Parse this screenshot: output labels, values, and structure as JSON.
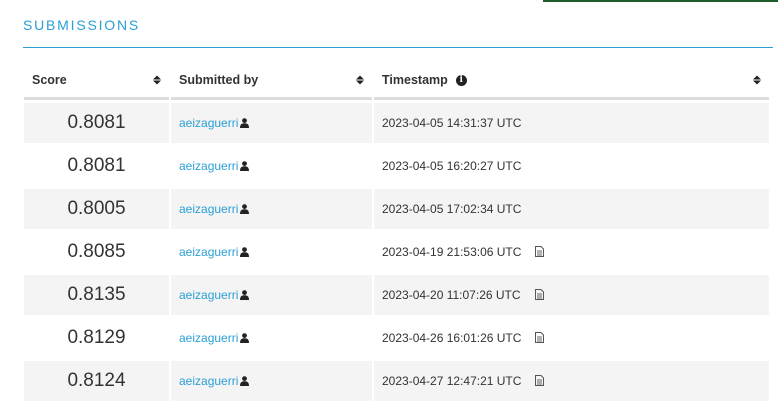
{
  "section_title": "SUBMISSIONS",
  "columns": {
    "score": "Score",
    "submitted_by": "Submitted by",
    "timestamp": "Timestamp"
  },
  "rows": [
    {
      "score": "0.8081",
      "user": "aeizaguerri",
      "timestamp": "2023-04-05 14:31:37 UTC",
      "has_file": false
    },
    {
      "score": "0.8081",
      "user": "aeizaguerri",
      "timestamp": "2023-04-05 16:20:27 UTC",
      "has_file": false
    },
    {
      "score": "0.8005",
      "user": "aeizaguerri",
      "timestamp": "2023-04-05 17:02:34 UTC",
      "has_file": false
    },
    {
      "score": "0.8085",
      "user": "aeizaguerri",
      "timestamp": "2023-04-19 21:53:06 UTC",
      "has_file": true
    },
    {
      "score": "0.8135",
      "user": "aeizaguerri",
      "timestamp": "2023-04-20 11:07:26 UTC",
      "has_file": true
    },
    {
      "score": "0.8129",
      "user": "aeizaguerri",
      "timestamp": "2023-04-26 16:01:26 UTC",
      "has_file": true
    },
    {
      "score": "0.8124",
      "user": "aeizaguerri",
      "timestamp": "2023-04-27 12:47:21 UTC",
      "has_file": true
    }
  ],
  "icons": {
    "user": "user-icon",
    "file": "file-icon",
    "info": "info-icon",
    "sort": "sort-icon"
  },
  "colors": {
    "accent": "#2a9fd6",
    "row_alt": "#f4f4f4",
    "top_bar": "#1e5e2a"
  }
}
